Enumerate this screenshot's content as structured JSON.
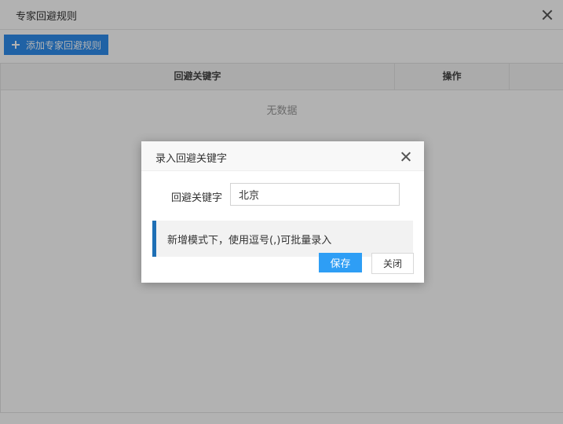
{
  "window": {
    "title": "专家回避规则"
  },
  "toolbar": {
    "add_label": "添加专家回避规则"
  },
  "table": {
    "columns": [
      "回避关键字",
      "操作"
    ],
    "empty_text": "无数据"
  },
  "dialog": {
    "title": "录入回避关键字",
    "field_label": "回避关键字",
    "field_value": "北京",
    "tip": "新增模式下，使用逗号(,)可批量录入",
    "save_label": "保存",
    "close_label": "关闭"
  },
  "colors": {
    "primary": "#2e8ded",
    "save": "#2e9ef5",
    "tip_border": "#1e6fb5"
  }
}
